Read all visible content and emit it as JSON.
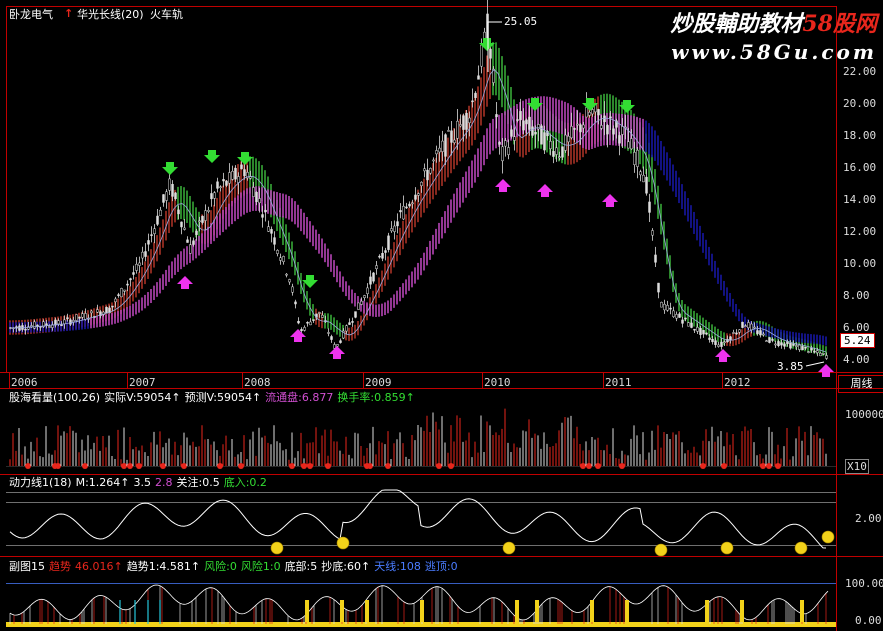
{
  "header": {
    "stock_name": "卧龙电气",
    "indicator_arrow": "↑",
    "indicator_name": "华光长线(20)",
    "indicator_extra": "火车轨"
  },
  "watermark": {
    "line1_a": "炒股輔助教材",
    "line1_b": "58股网",
    "line2": "www.58Gu.com"
  },
  "main_chart": {
    "high_label": "25.05",
    "low_label": "3.85",
    "current_price": "5.24",
    "y_ticks": [
      "22.00",
      "20.00",
      "18.00",
      "16.00",
      "14.00",
      "12.00",
      "10.00",
      "8.00",
      "6.00",
      "4.00"
    ],
    "x_years": [
      "2006",
      "2007",
      "2008",
      "2009",
      "2010",
      "2011",
      "2012"
    ],
    "period_label": "周线"
  },
  "volume_panel": {
    "title": "股海看量(100,26)",
    "actual_label": "实际V:59054↑",
    "forecast_label": "预测V:59054↑",
    "float_label": "流通盘:6.877",
    "turnover_label": "换手率:0.859↑",
    "y_tick": "100000",
    "unit_tick": "X10"
  },
  "momentum_panel": {
    "title": "动力线1(18)",
    "m_label": "M:1.264↑",
    "v1": "3.5",
    "v2": "2.8",
    "attention_label": "关注:0.5",
    "bottom_in_label": "底入:0.2",
    "y_tick": "2.00"
  },
  "sub_panel": {
    "title": "副图15",
    "trend_label": "趋势",
    "trend_value": "46.016↑",
    "trend1_label": "趋势1:4.581↑",
    "risk_label": "风险:0",
    "risk1_label": "风险1:0",
    "bottom_label": "底部:5",
    "copy_bottom_label": "抄底:60↑",
    "sky_line_label": "天线:108",
    "escape_top_label": "逃顶:0",
    "y_tick": "100.00",
    "y_tick2": "0.00"
  },
  "colors": {
    "background": "#000000",
    "rising": "#e8261c",
    "falling": "#26c6da",
    "band_up": "#c0392b",
    "band_down": "#3fbf3f",
    "band_magenta": "#d14fd1",
    "band_blue": "#1a1ab8",
    "grid_red": "#c00000",
    "arrow_green": "#33dd33",
    "arrow_magenta": "#ee33ee",
    "smiley": "#f2d21a"
  }
}
